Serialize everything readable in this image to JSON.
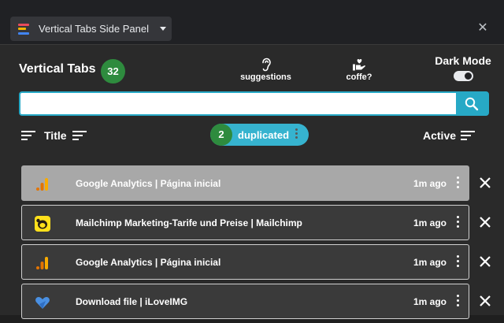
{
  "panel": {
    "selector_label": "Vertical Tabs Side Panel",
    "close_icon": "close-icon"
  },
  "header": {
    "title": "Vertical Tabs",
    "tab_count": "32",
    "suggestions_label": "suggestions",
    "coffee_label": "coffe?",
    "dark_mode_label": "Dark Mode",
    "dark_mode_on": true
  },
  "search": {
    "value": "",
    "placeholder": ""
  },
  "sort": {
    "title_label": "Title",
    "duplicated_count": "2",
    "duplicated_label": "duplicated",
    "active_label": "Active"
  },
  "tabs": [
    {
      "title": "Google Analytics | Página inicial",
      "time": "1m ago",
      "icon": "google-analytics-icon",
      "active": true
    },
    {
      "title": "Mailchimp Marketing-Tarife und Preise | Mailchimp",
      "time": "1m ago",
      "icon": "mailchimp-icon",
      "active": false
    },
    {
      "title": "Google Analytics | Página inicial",
      "time": "1m ago",
      "icon": "google-analytics-icon",
      "active": false
    },
    {
      "title": "Download file | iLoveIMG",
      "time": "1m ago",
      "icon": "iloveimg-icon",
      "active": false
    }
  ],
  "colors": {
    "accent": "#27a9c6",
    "badge": "#2e8b3e",
    "active_row": "#a8a8a8"
  }
}
